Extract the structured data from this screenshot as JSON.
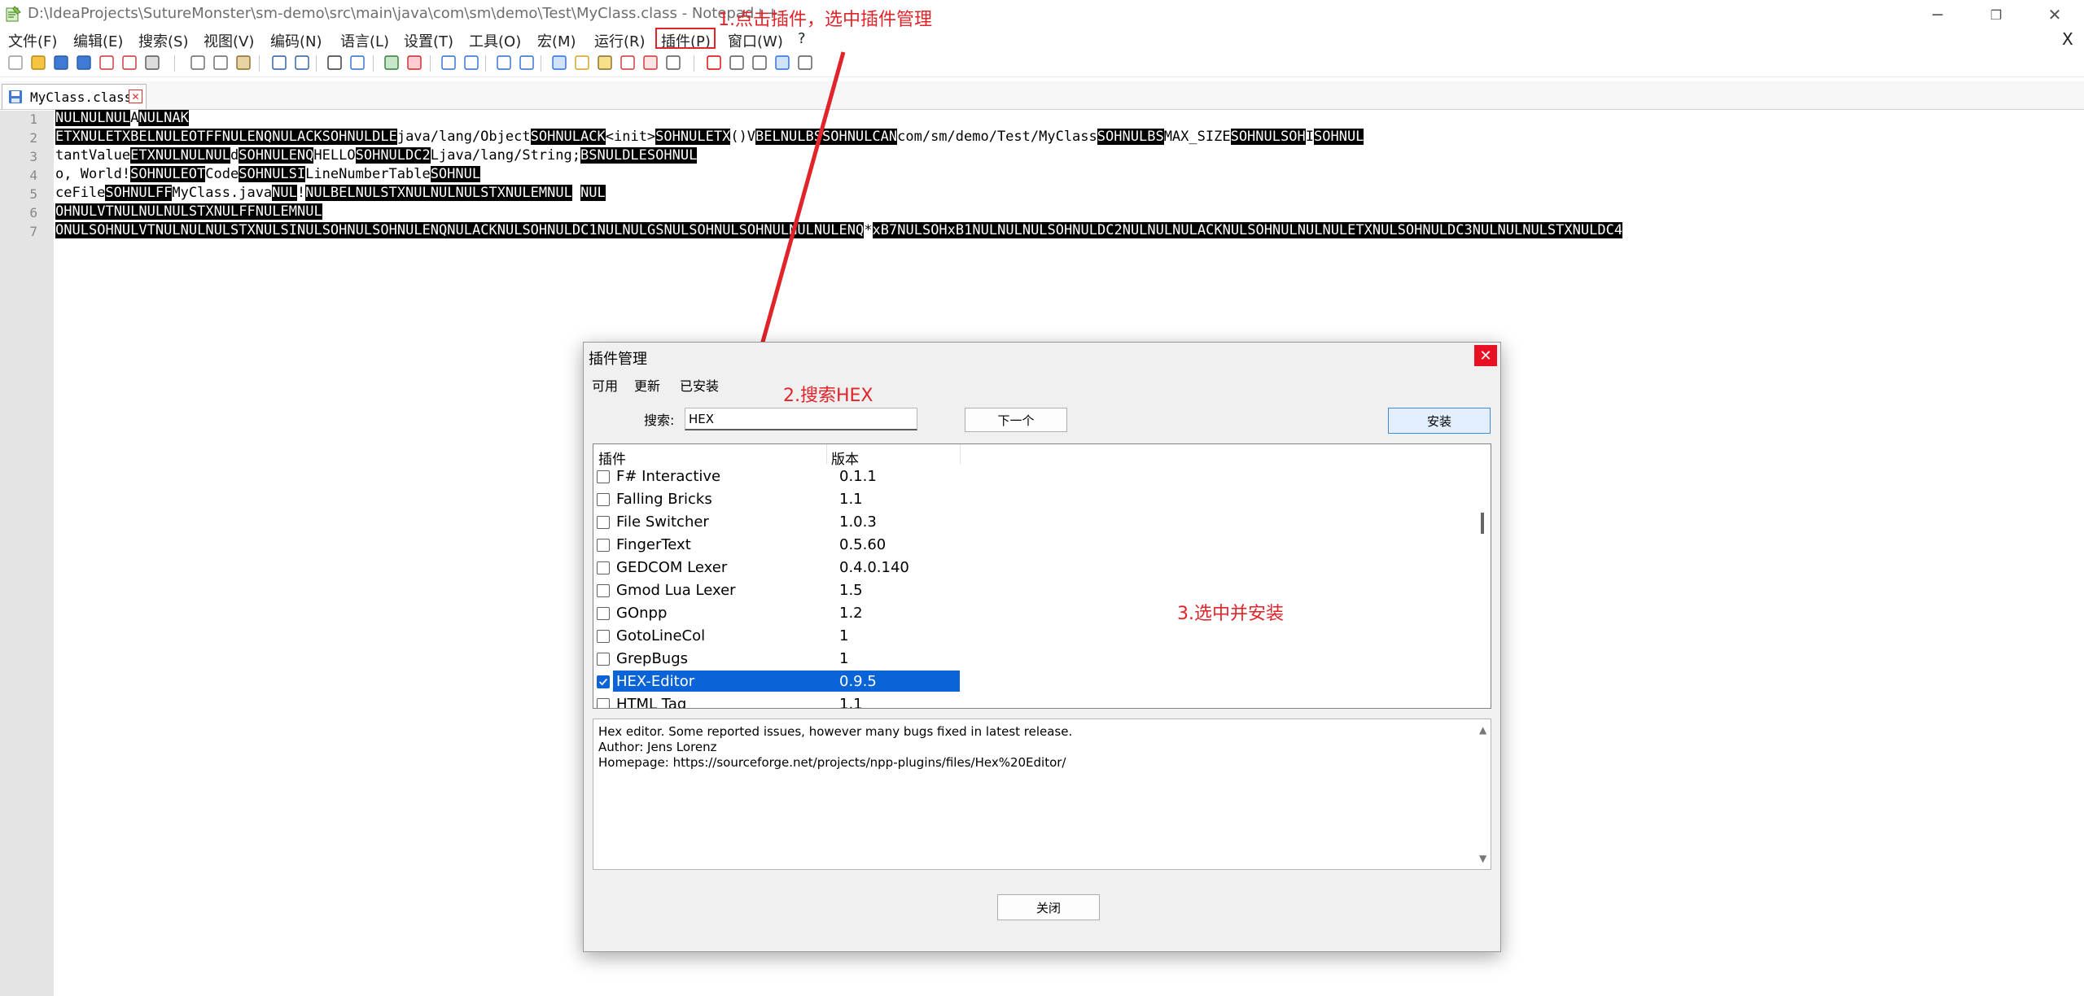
{
  "window": {
    "title": "D:\\IdeaProjects\\SutureMonster\\sm-demo\\src\\main\\java\\com\\sm\\demo\\Test\\MyClass.class - Notepad++",
    "minimize": "─",
    "restore": "❐",
    "close": "✕"
  },
  "menu": {
    "items": [
      "文件(F)",
      "编辑(E)",
      "搜索(S)",
      "视图(V)",
      "编码(N)",
      "语言(L)",
      "设置(T)",
      "工具(O)",
      "宏(M)",
      "运行(R)",
      "插件(P)",
      "窗口(W)",
      "?"
    ],
    "close_x": "X"
  },
  "tab": {
    "label": "MyClass.class",
    "close": "✕"
  },
  "editor": {
    "line_numbers": [
      "1",
      "2",
      "3",
      "4",
      "5",
      "6",
      "7"
    ],
    "lines": [
      [
        [
          "NUL",
          1
        ],
        [
          "NUL",
          1
        ],
        [
          "NUL",
          1
        ],
        [
          "A",
          0
        ],
        [
          "NUL",
          1
        ],
        [
          "NAK",
          1
        ]
      ],
      [
        [
          "ETX",
          1
        ],
        [
          "NUL",
          1
        ],
        [
          "ETX",
          1
        ],
        [
          "BEL",
          1
        ],
        [
          "NUL",
          1
        ],
        [
          "EOT",
          1
        ],
        [
          "FF",
          1
        ],
        [
          "NUL",
          1
        ],
        [
          "ENQ",
          1
        ],
        [
          "NUL",
          1
        ],
        [
          "ACK",
          1
        ],
        [
          "SOH",
          1
        ],
        [
          "NUL",
          1
        ],
        [
          "DLE",
          1
        ],
        [
          "java/lang/Object",
          0
        ],
        [
          "SOH",
          1
        ],
        [
          "NUL",
          1
        ],
        [
          "ACK",
          1
        ],
        [
          "<init>",
          0
        ],
        [
          "SOH",
          1
        ],
        [
          "NUL",
          1
        ],
        [
          "ETX",
          1
        ],
        [
          "()V",
          0
        ],
        [
          "BEL",
          1
        ],
        [
          "NUL",
          1
        ],
        [
          "BS",
          1
        ],
        [
          "SOH",
          1
        ],
        [
          "NUL",
          1
        ],
        [
          "CAN",
          1
        ],
        [
          "com/sm/demo/Test/MyClass",
          0
        ],
        [
          "SOH",
          1
        ],
        [
          "NUL",
          1
        ],
        [
          "BS",
          1
        ],
        [
          "MAX_SIZE",
          0
        ],
        [
          "SOH",
          1
        ],
        [
          "NUL",
          1
        ],
        [
          "SOH",
          1
        ],
        [
          "I",
          0
        ],
        [
          "SOH",
          1
        ],
        [
          "NUL",
          1
        ]
      ],
      [
        [
          "tantValue",
          0
        ],
        [
          "ETX",
          1
        ],
        [
          "NUL",
          1
        ],
        [
          "NUL",
          1
        ],
        [
          "NUL",
          1
        ],
        [
          "d",
          0
        ],
        [
          "SOH",
          1
        ],
        [
          "NUL",
          1
        ],
        [
          "ENQ",
          1
        ],
        [
          "HELLO",
          0
        ],
        [
          "SOH",
          1
        ],
        [
          "NUL",
          1
        ],
        [
          "DC2",
          1
        ],
        [
          "Ljava/lang/String;",
          0
        ],
        [
          "BS",
          1
        ],
        [
          "NUL",
          1
        ],
        [
          "DLE",
          1
        ],
        [
          "SOH",
          1
        ],
        [
          "NUL",
          1
        ]
      ],
      [
        [
          "o, World!",
          0
        ],
        [
          "SOH",
          1
        ],
        [
          "NUL",
          1
        ],
        [
          "EOT",
          1
        ],
        [
          "Code",
          0
        ],
        [
          "SOH",
          1
        ],
        [
          "NUL",
          1
        ],
        [
          "SI",
          1
        ],
        [
          "LineNumberTable",
          0
        ],
        [
          "SOH",
          1
        ],
        [
          "NUL",
          1
        ]
      ],
      [
        [
          "ceFile",
          0
        ],
        [
          "SOH",
          1
        ],
        [
          "NUL",
          1
        ],
        [
          "FF",
          1
        ],
        [
          "MyClass.java",
          0
        ],
        [
          "NUL",
          1
        ],
        [
          "!",
          0
        ],
        [
          "NUL",
          1
        ],
        [
          "BEL",
          1
        ],
        [
          "NUL",
          1
        ],
        [
          "STX",
          1
        ],
        [
          "NUL",
          1
        ],
        [
          "NUL",
          1
        ],
        [
          "NUL",
          1
        ],
        [
          "STX",
          1
        ],
        [
          "NUL",
          1
        ],
        [
          "EM",
          1
        ],
        [
          "NUL",
          1
        ],
        [
          "  ",
          0
        ],
        [
          "NUL",
          1
        ]
      ],
      [
        [
          "OH",
          1
        ],
        [
          "NUL",
          1
        ],
        [
          "VT",
          1
        ],
        [
          "NUL",
          1
        ],
        [
          "NUL",
          1
        ],
        [
          "NUL",
          1
        ],
        [
          "STX",
          1
        ],
        [
          "NUL",
          1
        ],
        [
          "FF",
          1
        ],
        [
          "NUL",
          1
        ],
        [
          "EM",
          1
        ],
        [
          "NUL",
          1
        ]
      ],
      [
        [
          "O",
          1
        ],
        [
          "NUL",
          1
        ],
        [
          "SOH",
          1
        ],
        [
          "NUL",
          1
        ],
        [
          "VT",
          1
        ],
        [
          "NUL",
          1
        ],
        [
          "NUL",
          1
        ],
        [
          "NUL",
          1
        ],
        [
          "STX",
          1
        ],
        [
          "NUL",
          1
        ],
        [
          "SI",
          1
        ],
        [
          "NUL",
          1
        ],
        [
          "SOH",
          1
        ],
        [
          "NUL",
          1
        ],
        [
          "SOH",
          1
        ],
        [
          "NUL",
          1
        ],
        [
          "ENQ",
          1
        ],
        [
          "NUL",
          1
        ],
        [
          "ACK",
          1
        ],
        [
          "NUL",
          1
        ],
        [
          "SOH",
          1
        ],
        [
          "NUL",
          1
        ],
        [
          "DC1",
          1
        ],
        [
          "NUL",
          1
        ],
        [
          "NUL",
          1
        ],
        [
          "GS",
          1
        ],
        [
          "NUL",
          1
        ],
        [
          "SOH",
          1
        ],
        [
          "NUL",
          1
        ],
        [
          "SOH",
          1
        ],
        [
          "NUL",
          1
        ],
        [
          "NUL",
          1
        ],
        [
          "NUL",
          1
        ],
        [
          "ENQ",
          1
        ],
        [
          "*",
          0
        ],
        [
          "xB7",
          1
        ],
        [
          "NUL",
          1
        ],
        [
          "SOH",
          1
        ],
        [
          "xB1",
          1
        ],
        [
          "NUL",
          1
        ],
        [
          "NUL",
          1
        ],
        [
          "NUL",
          1
        ],
        [
          "SOH",
          1
        ],
        [
          "NUL",
          1
        ],
        [
          "DC2",
          1
        ],
        [
          "NUL",
          1
        ],
        [
          "NUL",
          1
        ],
        [
          "NUL",
          1
        ],
        [
          "ACK",
          1
        ],
        [
          "NUL",
          1
        ],
        [
          "SOH",
          1
        ],
        [
          "NUL",
          1
        ],
        [
          "NUL",
          1
        ],
        [
          "NUL",
          1
        ],
        [
          "ETX",
          1
        ],
        [
          "NUL",
          1
        ],
        [
          "SOH",
          1
        ],
        [
          "NUL",
          1
        ],
        [
          "DC3",
          1
        ],
        [
          "NUL",
          1
        ],
        [
          "NUL",
          1
        ],
        [
          "NUL",
          1
        ],
        [
          "STX",
          1
        ],
        [
          "NUL",
          1
        ],
        [
          "DC4",
          1
        ]
      ]
    ]
  },
  "dialog": {
    "title": "插件管理",
    "close": "✕",
    "tabs": [
      "可用",
      "更新",
      "已安装"
    ],
    "search_label": "搜索:",
    "search_value": "HEX",
    "next_button": "下一个",
    "install_button": "安装",
    "columns": [
      "插件",
      "版本"
    ],
    "plugins": [
      {
        "name": "F# Interactive",
        "version": "0.1.1",
        "checked": false,
        "selected": false
      },
      {
        "name": "Falling Bricks",
        "version": "1.1",
        "checked": false,
        "selected": false
      },
      {
        "name": "File Switcher",
        "version": "1.0.3",
        "checked": false,
        "selected": false
      },
      {
        "name": "FingerText",
        "version": "0.5.60",
        "checked": false,
        "selected": false
      },
      {
        "name": "GEDCOM Lexer",
        "version": "0.4.0.140",
        "checked": false,
        "selected": false
      },
      {
        "name": "Gmod Lua Lexer",
        "version": "1.5",
        "checked": false,
        "selected": false
      },
      {
        "name": "GOnpp",
        "version": "1.2",
        "checked": false,
        "selected": false
      },
      {
        "name": "GotoLineCol",
        "version": "1",
        "checked": false,
        "selected": false
      },
      {
        "name": "GrepBugs",
        "version": "1",
        "checked": false,
        "selected": false
      },
      {
        "name": "HEX-Editor",
        "version": "0.9.5",
        "checked": true,
        "selected": true
      },
      {
        "name": "HTML Tag",
        "version": "1.1",
        "checked": false,
        "selected": false
      }
    ],
    "description": [
      "Hex editor. Some reported issues, however many bugs fixed in latest release.",
      "Author: Jens Lorenz",
      "Homepage: https://sourceforge.net/projects/npp-plugins/files/Hex%20Editor/"
    ],
    "close_button": "关闭"
  },
  "annotations": {
    "step1": "1.点击插件，选中插件管理",
    "step2": "2.搜索HEX",
    "step3": "3.选中并安装",
    "color": "#e0242a"
  },
  "colors": {
    "selection": "#0a64d8",
    "gutter": "#e4e4e4",
    "dialog_bg": "#f0f0f0",
    "close_red": "#e81123"
  }
}
